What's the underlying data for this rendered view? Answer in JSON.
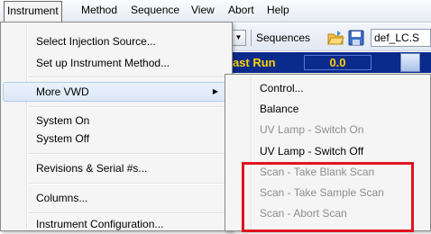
{
  "menubar": {
    "items": [
      "Instrument",
      "Method",
      "Sequence",
      "View",
      "Abort",
      "Help"
    ]
  },
  "toolbar": {
    "sequences_label": "Sequences",
    "file_value": "def_LC.S"
  },
  "status": {
    "label": "Last Run",
    "value": "0.0"
  },
  "instrument_menu": {
    "items": [
      {
        "label": "Select Injection Source..."
      },
      {
        "label": "Set up Instrument Method..."
      },
      {
        "label": "More VWD"
      },
      {
        "label": "System On"
      },
      {
        "label": "System Off"
      },
      {
        "label": "Revisions & Serial #s..."
      },
      {
        "label": "Columns..."
      },
      {
        "label": "Instrument Configuration..."
      }
    ]
  },
  "vwd_submenu": {
    "items": [
      {
        "label": "Control...",
        "enabled": true
      },
      {
        "label": "Balance",
        "enabled": true
      },
      {
        "label": "UV Lamp - Switch On",
        "enabled": false
      },
      {
        "label": "UV Lamp - Switch Off",
        "enabled": true
      },
      {
        "label": "Scan - Take Blank Scan",
        "enabled": false
      },
      {
        "label": "Scan - Take Sample Scan",
        "enabled": false
      },
      {
        "label": "Scan - Abort Scan",
        "enabled": false
      }
    ]
  },
  "colors": {
    "status_bg": "#0a2a8c",
    "status_text": "#ffd200",
    "highlight_box": "#e0141e",
    "disabled_text": "#8d8d8d"
  }
}
